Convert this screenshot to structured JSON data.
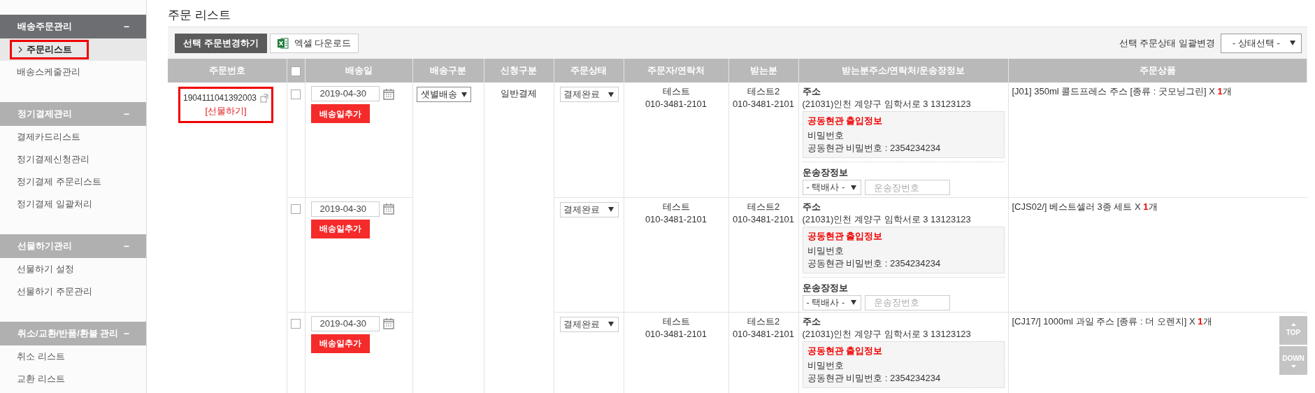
{
  "sidebar": [
    {
      "title": "배송주문관리",
      "toggle": "−",
      "selected": true,
      "items": [
        {
          "label": "주문리스트",
          "selected": true,
          "highlighted": true
        },
        {
          "label": "배송스케줄관리",
          "selected": false,
          "highlighted": false
        }
      ]
    },
    {
      "title": "정기결제관리",
      "toggle": "−",
      "selected": false,
      "items": [
        {
          "label": "결제카드리스트",
          "selected": false,
          "highlighted": false
        },
        {
          "label": "정기결제신청관리",
          "selected": false,
          "highlighted": false
        },
        {
          "label": "정기결제 주문리스트",
          "selected": false,
          "highlighted": false
        },
        {
          "label": "정기결제 일괄처리",
          "selected": false,
          "highlighted": false
        }
      ]
    },
    {
      "title": "선물하기관리",
      "toggle": "−",
      "selected": false,
      "items": [
        {
          "label": "선물하기 설정",
          "selected": false,
          "highlighted": false
        },
        {
          "label": "선물하기 주문관리",
          "selected": false,
          "highlighted": false
        }
      ]
    },
    {
      "title": "취소/교환/반품/환불 관리",
      "toggle": "−",
      "selected": false,
      "items": [
        {
          "label": "취소 리스트",
          "selected": false,
          "highlighted": false
        },
        {
          "label": "교환 리스트",
          "selected": false,
          "highlighted": false
        }
      ]
    }
  ],
  "page_title": "주문 리스트",
  "toolbar": {
    "change_button": "선택 주문변경하기",
    "excel_button": "엑셀 다운로드",
    "bulk_label": "선택 주문상태 일괄변경",
    "bulk_select": "- 상태선택 -"
  },
  "table": {
    "columns": [
      "주문번호",
      "배송일",
      "배송구분",
      "신청구분",
      "주문상태",
      "주문자/연락처",
      "받는분",
      "받는분주소/연락처/운송장정보",
      "주문상품"
    ],
    "header_checked": false,
    "order": {
      "number": "1904111041392003",
      "gift": "[선물하기]",
      "highlighted": true,
      "delivery_type": "샛별배송",
      "request_type": "일반결제"
    },
    "rows": [
      {
        "checked": false,
        "date": "2019-04-30",
        "add_button": "배송일추가",
        "status": "결제완료",
        "orderer": "테스트",
        "orderer_phone": "010-3481-2101",
        "recipient": "테스트2",
        "recipient_phone": "010-3481-2101",
        "address_label": "주소",
        "address": "(21031)인천 계양구 임학서로 3 13123123",
        "entry_title": "공동현관 출입정보",
        "entry_label": "비밀번호",
        "entry_value": "공동현관 비밀번호 : 2354234234",
        "waybill": {
          "label": "운송장정보",
          "courier": "- 택배사 -",
          "placeholder": "운송장번호"
        },
        "product": "[J01] 350ml 콜드프레스 주스 [종류 : 굿모닝그린] X **1**개"
      },
      {
        "checked": false,
        "date": "2019-04-30",
        "add_button": "배송일추가",
        "status": "결제완료",
        "orderer": "테스트",
        "orderer_phone": "010-3481-2101",
        "recipient": "테스트2",
        "recipient_phone": "010-3481-2101",
        "address_label": "주소",
        "address": "(21031)인천 계양구 임학서로 3 13123123",
        "entry_title": "공동현관 출입정보",
        "entry_label": "비밀번호",
        "entry_value": "공동현관 비밀번호 : 2354234234",
        "waybill": {
          "label": "운송장정보",
          "courier": "- 택배사 -",
          "placeholder": "운송장번호"
        },
        "product": "[CJS02/] 베스트셀러 3종 세트 X **1**개"
      },
      {
        "checked": false,
        "date": "2019-04-30",
        "add_button": "배송일추가",
        "status": "결제완료",
        "orderer": "테스트",
        "orderer_phone": "010-3481-2101",
        "recipient": "테스트2",
        "recipient_phone": "010-3481-2101",
        "address_label": "주소",
        "address": "(21031)인천 계양구 임학서로 3 13123123",
        "entry_title": "공동현관 출입정보",
        "entry_label": "비밀번호",
        "entry_value": "공동현관 비밀번호 : 2354234234",
        "product": "[CJ17/] 1000ml 과일 주스 [종류 : 더 오렌지] X **1**개"
      }
    ]
  },
  "scroll_buttons": [
    "TOP",
    "DOWN"
  ]
}
